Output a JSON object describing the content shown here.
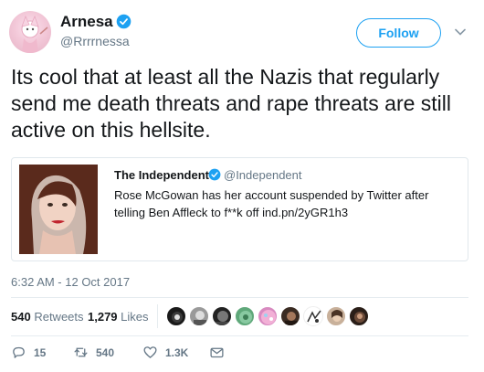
{
  "author": {
    "name": "Arnesa",
    "handle": "@Rrrrnessa",
    "verified": true
  },
  "follow_button": {
    "label": "Follow"
  },
  "tweet": {
    "text": "Its cool that at least all the Nazis that regularly send me death threats and rape threats are still active on this hellsite."
  },
  "quoted_tweet": {
    "name": "The Independent",
    "handle": "@Independent",
    "verified": true,
    "text": "Rose McGowan has her account suspended by Twitter after telling Ben Affleck to f**k off ind.pn/2yGR1h3"
  },
  "timestamp": "6:32 AM - 12 Oct 2017",
  "stats": {
    "retweets_count": "540",
    "retweets_label": "Retweets",
    "likes_count": "1,279",
    "likes_label": "Likes"
  },
  "actions": {
    "replies": "15",
    "retweets": "540",
    "likes": "1.3K"
  },
  "colors": {
    "accent": "#1da1f2",
    "text": "#14171a",
    "muted": "#657786",
    "border": "#e1e8ed"
  },
  "icons": [
    "verified-badge-icon",
    "chevron-down-icon",
    "reply-icon",
    "retweet-icon",
    "like-icon",
    "direct-message-icon"
  ]
}
